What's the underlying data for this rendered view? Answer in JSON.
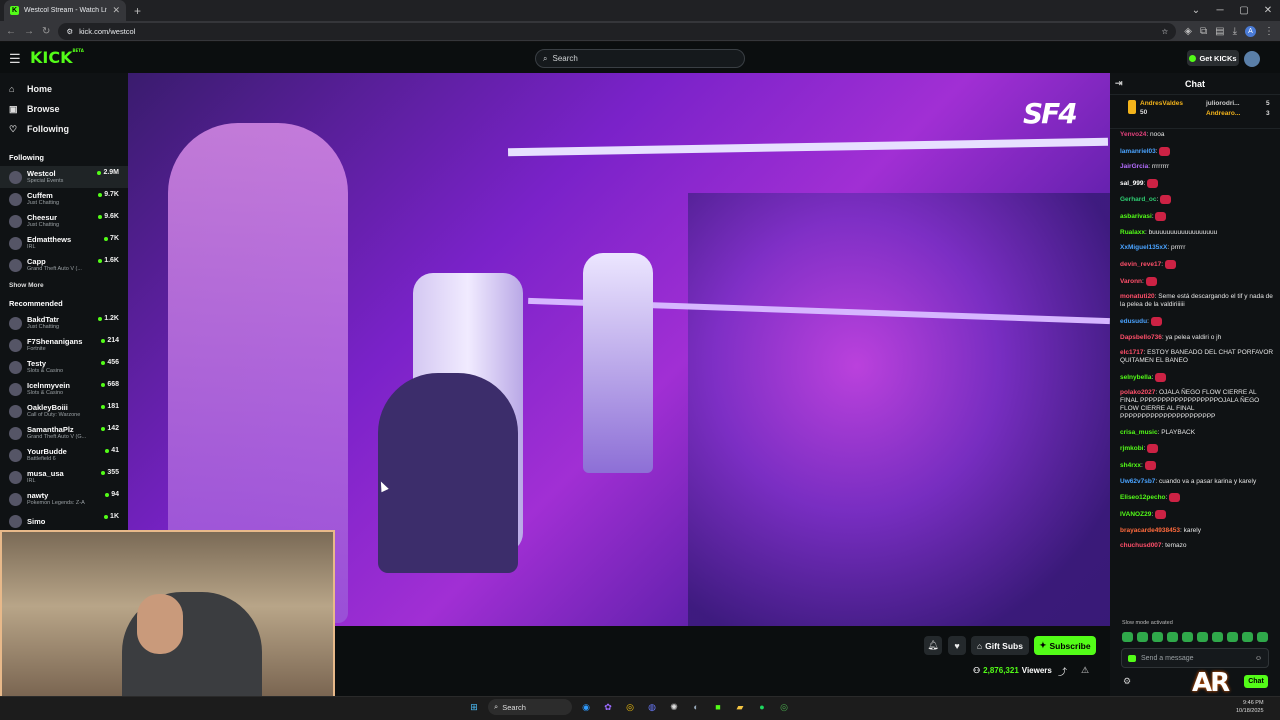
{
  "browser": {
    "tab_title": "Westcol Stream - Watch Live o",
    "url": "kick.com/westcol",
    "favicon_letter": "K"
  },
  "header": {
    "logo": "KICK",
    "logo_badge": "BETA",
    "search_placeholder": "Search",
    "get_kicks_label": "Get KICKs"
  },
  "sidebar": {
    "nav": [
      {
        "label": "Home",
        "icon": "home-icon"
      },
      {
        "label": "Browse",
        "icon": "browse-icon"
      },
      {
        "label": "Following",
        "icon": "heart-icon"
      }
    ],
    "following_title": "Following",
    "following": [
      {
        "name": "Westcol",
        "category": "Special Events",
        "viewers": "2.9M",
        "active": true
      },
      {
        "name": "Cuffem",
        "category": "Just Chatting",
        "viewers": "9.7K"
      },
      {
        "name": "Cheesur",
        "category": "Just Chatting",
        "viewers": "9.6K"
      },
      {
        "name": "Edmatthews",
        "category": "IRL",
        "viewers": "7K"
      },
      {
        "name": "Capp",
        "category": "Grand Theft Auto V (...",
        "viewers": "1.6K"
      }
    ],
    "show_more": "Show More",
    "recommended_title": "Recommended",
    "recommended": [
      {
        "name": "BakdTatr",
        "category": "Just Chatting",
        "viewers": "1.2K"
      },
      {
        "name": "F7Shenanigans",
        "category": "Fortnite",
        "viewers": "214"
      },
      {
        "name": "Testy",
        "category": "Slots & Casino",
        "viewers": "456"
      },
      {
        "name": "Icelnmyvein",
        "category": "Slots & Casino",
        "viewers": "668"
      },
      {
        "name": "OakleyBoiii",
        "category": "Call of Duty: Warzone",
        "viewers": "181"
      },
      {
        "name": "SamanthaPlz",
        "category": "Grand Theft Auto V (G...",
        "viewers": "142"
      },
      {
        "name": "YourBudde",
        "category": "Battlefield 6",
        "viewers": "41"
      },
      {
        "name": "musa_usa",
        "category": "IRL",
        "viewers": "355"
      },
      {
        "name": "nawty",
        "category": "Pokemon Legends: Z-A",
        "viewers": "94"
      },
      {
        "name": "Simo",
        "category": "",
        "viewers": "1K"
      }
    ]
  },
  "video": {
    "overlay_logo": "SF4"
  },
  "actions": {
    "gift_subs": "Gift Subs",
    "subscribe": "Subscribe",
    "viewers_count": "2,876,321",
    "viewers_label": "Viewers"
  },
  "chat": {
    "title": "Chat",
    "leaderboard": [
      {
        "name": "AndresValdes",
        "score": "50"
      },
      {
        "name": "juliorodri...",
        "score": "5"
      },
      {
        "name": "Andrearo...",
        "score": "3"
      }
    ],
    "messages": [
      {
        "user": "Yenvo24",
        "text": "nooa",
        "color": "#e0407a"
      },
      {
        "user": "lamanriel03",
        "text": "",
        "color": "#4aa3ff"
      },
      {
        "user": "JairGrcia",
        "text": "rrrrrrrr",
        "color": "#b46cff"
      },
      {
        "user": "sal_999",
        "text": "",
        "color": "#ffffff"
      },
      {
        "user": "Gerhard_oc",
        "text": "",
        "color": "#2ecc71"
      },
      {
        "user": "asbarivasi",
        "text": "",
        "color": "#53fc18"
      },
      {
        "user": "Rualaxx",
        "text": "buuuuuuuuuuuuuuuuuu",
        "color": "#53fc18"
      },
      {
        "user": "XxMiguel135xX",
        "text": "prrrrr",
        "color": "#4aa3ff"
      },
      {
        "user": "devin_reve17",
        "text": "",
        "color": "#ff4f6a"
      },
      {
        "user": "Varonn",
        "text": "",
        "color": "#ff4f6a"
      },
      {
        "user": "monatuti20",
        "text": "Seme está descargando el tif y nada de la pelea de la valdiriiiiii",
        "color": "#ff4f6a"
      },
      {
        "user": "edusudu",
        "text": "",
        "color": "#4aa3ff"
      },
      {
        "user": "Dapsbello736",
        "text": "ya pelea valdiri o jh",
        "color": "#ff4f6a"
      },
      {
        "user": "elc1717",
        "text": "ESTOY BANEADO DEL CHAT PORFAVOR QUITAMEN EL BANEO",
        "color": "#ff4f6a"
      },
      {
        "user": "selnybella",
        "text": "",
        "color": "#53fc18"
      },
      {
        "user": "polako2027",
        "text": "OJALA ÑEGO FLOW CIERRE AL FINAL PPPPPPPPPPPPPPPPPPOJALA ÑEGO FLOW CIERRE AL FINAL PPPPPPPPPPPPPPPPPPPPPP",
        "color": "#ff4f6a"
      },
      {
        "user": "crisa_music",
        "text": "PLAYBACK",
        "color": "#53fc18"
      },
      {
        "user": "rjmkobi",
        "text": "",
        "color": "#53fc18"
      },
      {
        "user": "sh4rxx",
        "text": "",
        "color": "#53fc18"
      },
      {
        "user": "Uw62v7sb7",
        "text": "cuando va a pasar karina y karely",
        "color": "#4aa3ff"
      },
      {
        "user": "Eliseo12pecho",
        "text": "",
        "color": "#53fc18"
      },
      {
        "user": "IVANOZ29",
        "text": "",
        "color": "#53fc18"
      },
      {
        "user": "brayacarde4938453",
        "text": "karely",
        "color": "#ff6a3d"
      },
      {
        "user": "chuchusd007",
        "text": "temazo",
        "color": "#ff4f6a"
      }
    ],
    "slow_mode": "Slow mode activated",
    "input_placeholder": "Send a message",
    "chat_button": "Chat"
  },
  "taskbar": {
    "search_label": "Search",
    "time": "9:46 PM",
    "date": "10/18/2025"
  },
  "brand": {
    "accent": "#53fc18",
    "background": "#0b0e0f"
  }
}
